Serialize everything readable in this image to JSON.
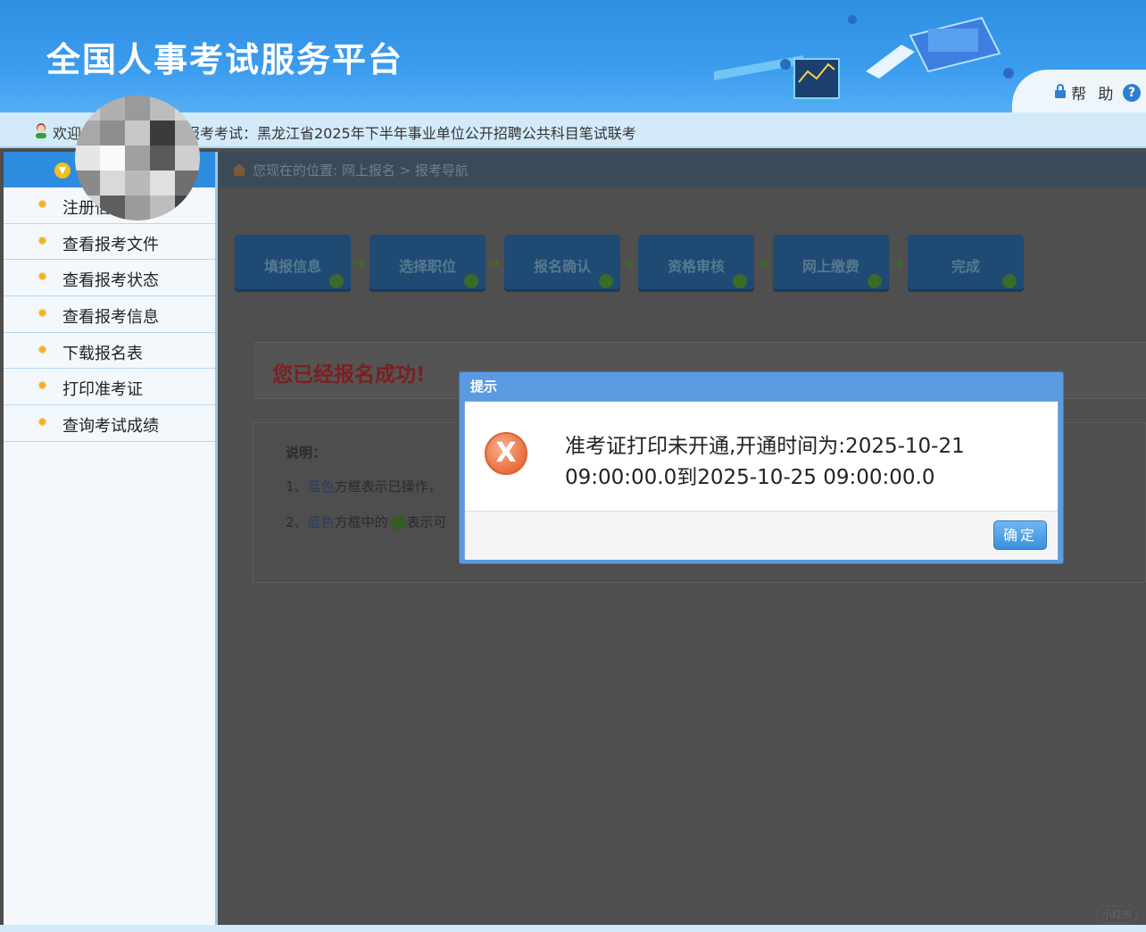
{
  "header": {
    "title": "全国人事考试服务平台",
    "help_label": "帮 助",
    "help_icon": "question-icon"
  },
  "welcome": {
    "prefix": "欢迎",
    "exam_label": "报考考试：黑龙江省2025年下半年事业单位公开招聘公共科目笔试联考"
  },
  "sidebar": {
    "items": [
      {
        "label": "注册信"
      },
      {
        "label": "查看报考文件"
      },
      {
        "label": "查看报考状态"
      },
      {
        "label": "查看报考信息"
      },
      {
        "label": "下载报名表"
      },
      {
        "label": "打印准考证"
      },
      {
        "label": "查询考试成绩"
      }
    ]
  },
  "breadcrumb": {
    "text": "您现在的位置:  网上报名  >  报考导航"
  },
  "steps": [
    {
      "label": "填报信息"
    },
    {
      "label": "选择职位"
    },
    {
      "label": "报名确认"
    },
    {
      "label": "资格审核"
    },
    {
      "label": "网上缴费"
    },
    {
      "label": "完成"
    }
  ],
  "success_message": "您已经报名成功!",
  "notes": {
    "title": "说明：",
    "line1_prefix": "1、",
    "line1_blue": "蓝色",
    "line1_rest": "方框表示已操作，",
    "line2_prefix": "2、",
    "line2_blue": "蓝色",
    "line2_rest": "方框中的",
    "line2_tail": "表示可"
  },
  "dialog": {
    "title": "提示",
    "message_line1": "准考证打印未开通,开通时间为:2025-10-21",
    "message_line2": "09:00:00.0到2025-10-25 09:00:00.0",
    "ok_label": "确定",
    "icon": "error-icon"
  },
  "watermark": "小红书"
}
